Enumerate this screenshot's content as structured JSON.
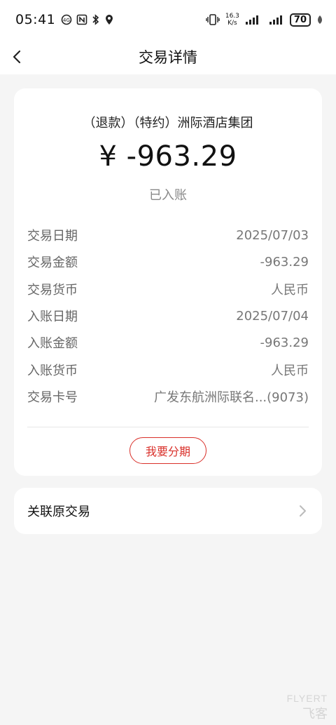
{
  "status_bar": {
    "time": "05:41",
    "net_speed_value": "16.3",
    "net_speed_unit": "K/s",
    "battery": "70"
  },
  "nav": {
    "title": "交易详情"
  },
  "transaction": {
    "merchant": "（退款）（特约）洲际酒店集团",
    "amount": "¥ -963.29",
    "status": "已入账",
    "details": [
      {
        "label": "交易日期",
        "value": "2025/07/03"
      },
      {
        "label": "交易金额",
        "value": "-963.29"
      },
      {
        "label": "交易货币",
        "value": "人民币"
      },
      {
        "label": "入账日期",
        "value": "2025/07/04"
      },
      {
        "label": "入账金额",
        "value": "-963.29"
      },
      {
        "label": "入账货币",
        "value": "人民币"
      },
      {
        "label": "交易卡号",
        "value": "广发东航洲际联名...(9073)"
      }
    ],
    "installment_button": "我要分期"
  },
  "related": {
    "label": "关联原交易"
  },
  "watermark": {
    "line1": "FLYERT",
    "line2": "飞客"
  },
  "colors": {
    "accent": "#d9302a",
    "background": "#f5f5f5",
    "card": "#ffffff"
  }
}
